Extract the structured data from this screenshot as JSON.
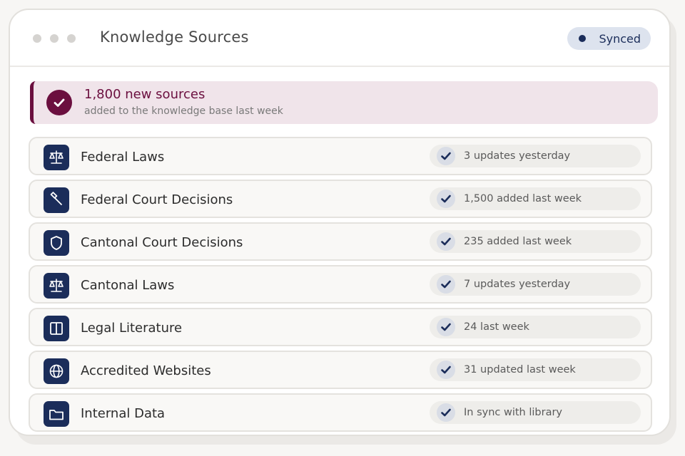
{
  "window": {
    "title": "Knowledge Sources",
    "sync_status": "Synced"
  },
  "banner": {
    "title": "1,800 new sources",
    "subtitle": "added to the knowledge base last week",
    "icon": "check-circle-icon",
    "accent": "#6b0f3f"
  },
  "sources": [
    {
      "label": "Federal Laws",
      "status": "3 updates yesterday",
      "icon": "scales-icon"
    },
    {
      "label": "Federal Court Decisions",
      "status": "1,500 added last week",
      "icon": "gavel-icon"
    },
    {
      "label": "Cantonal Court Decisions",
      "status": "235 added last week",
      "icon": "shield-icon"
    },
    {
      "label": "Cantonal Laws",
      "status": "7 updates yesterday",
      "icon": "scales-icon"
    },
    {
      "label": "Legal Literature",
      "status": "24 last week",
      "icon": "book-icon"
    },
    {
      "label": "Accredited Websites",
      "status": "31 updated last week",
      "icon": "globe-icon"
    },
    {
      "label": "Internal Data",
      "status": "In sync with library",
      "icon": "folder-icon"
    }
  ],
  "colors": {
    "navy": "#1b2d5a",
    "accent": "#6b0f3f",
    "synced_bg": "#dde3ee"
  }
}
